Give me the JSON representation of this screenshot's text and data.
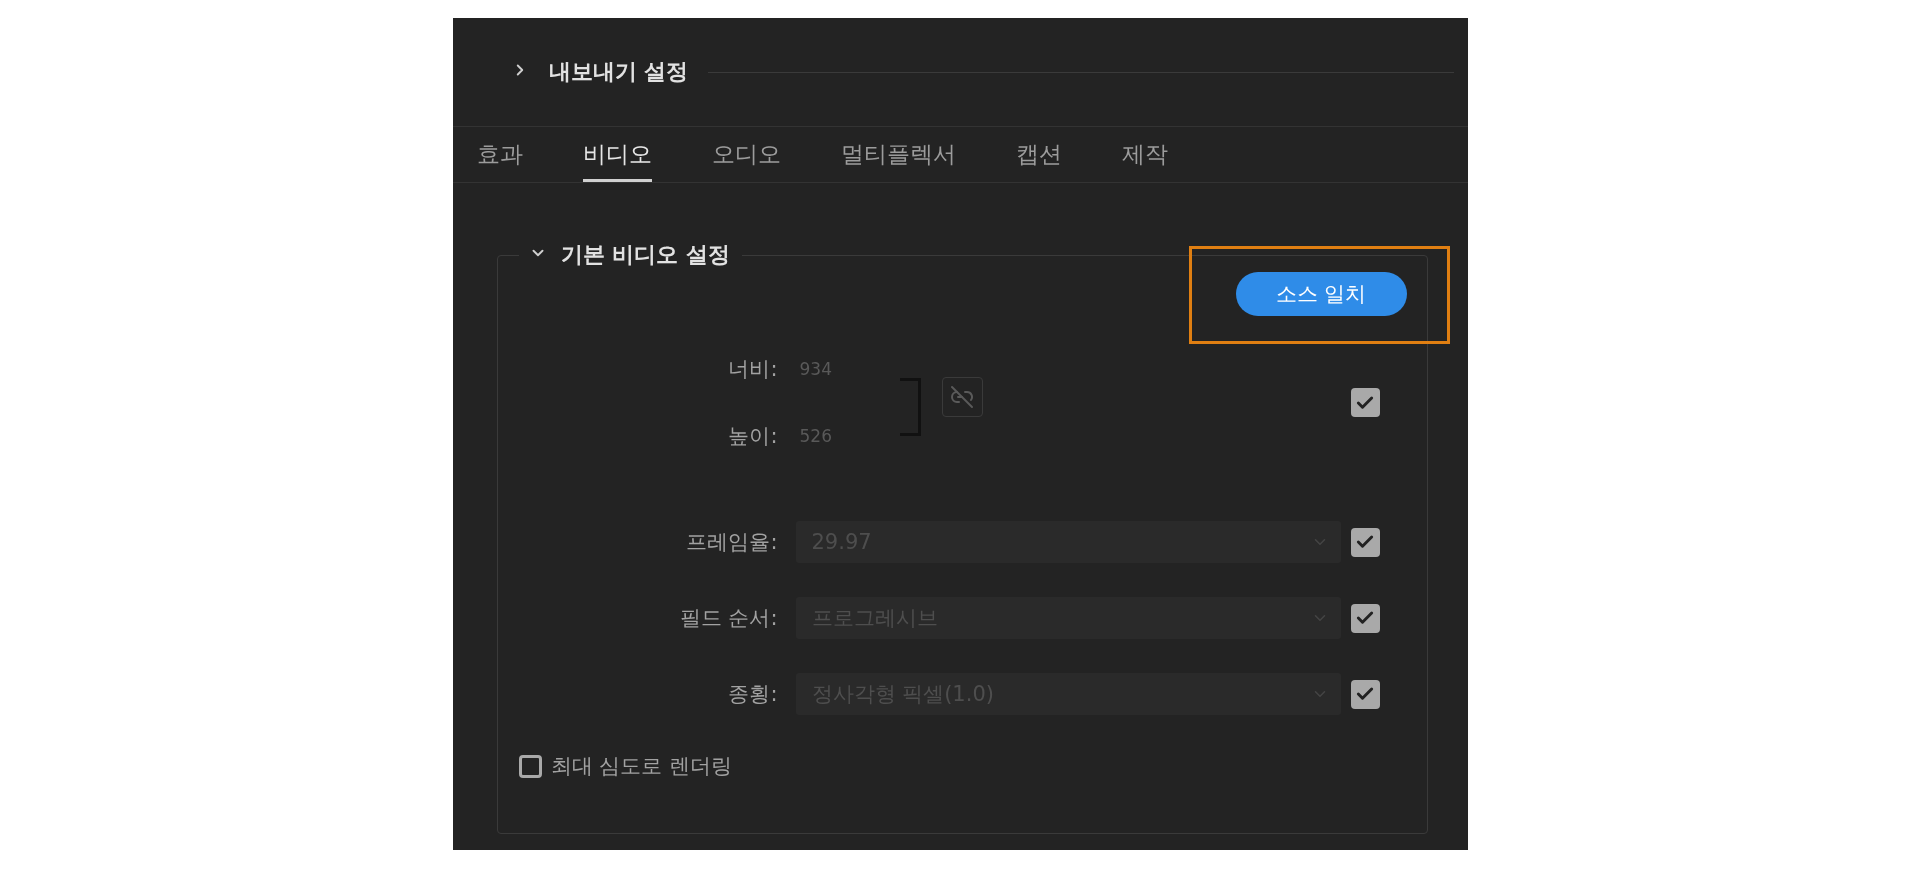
{
  "export_settings": {
    "title": "내보내기 설정",
    "expanded": false
  },
  "tabs": [
    {
      "label": "효과",
      "selected": false
    },
    {
      "label": "비디오",
      "selected": true
    },
    {
      "label": "오디오",
      "selected": false
    },
    {
      "label": "멀티플렉서",
      "selected": false
    },
    {
      "label": "캡션",
      "selected": false
    },
    {
      "label": "제작",
      "selected": false
    }
  ],
  "section": {
    "title": "기본 비디오 설정",
    "expanded": true,
    "match_source_button": {
      "label": "소스 일치",
      "highlighted": true
    },
    "dimensions": {
      "width_label": "너비:",
      "width_value": "934",
      "height_label": "높이:",
      "height_value": "526",
      "linked": false,
      "checked": true
    },
    "settings": [
      {
        "label": "프레임율:",
        "value": "29.97",
        "checked": true
      },
      {
        "label": "필드 순서:",
        "value": "프로그레시브",
        "checked": true
      },
      {
        "label": "종횡:",
        "value": "정사각형 픽셀(1.0)",
        "checked": true
      }
    ],
    "max_depth": {
      "label": "최대 심도로 렌더링",
      "checked": false
    }
  }
}
